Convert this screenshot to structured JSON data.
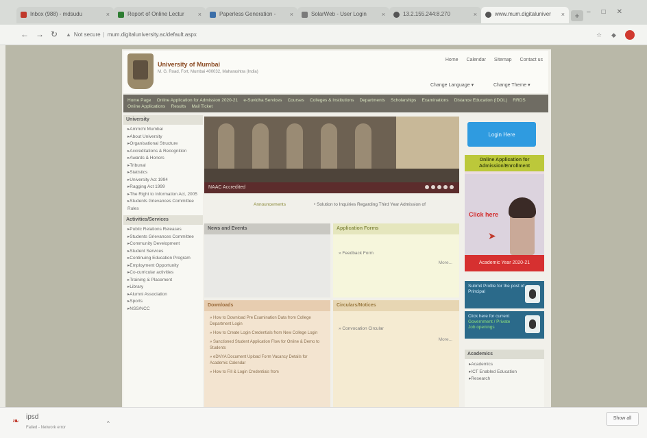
{
  "browser": {
    "tabs": [
      {
        "label": "Inbox (988) - mdsudu",
        "icon_color": "#c0392b"
      },
      {
        "label": "Report of Online Lectur",
        "icon_color": "#2e7d32"
      },
      {
        "label": "Paperless Generation -",
        "icon_color": "#3b6ea8"
      },
      {
        "label": "SolarWeb - User Login",
        "icon_color": "#7a7a7a"
      },
      {
        "label": "13.2.155.244:8.270",
        "icon_color": "#555555"
      },
      {
        "label": "www.mum.digitaluniver",
        "icon_color": "#555555"
      }
    ],
    "new_tab": "+",
    "address": {
      "security": "Not secure",
      "url": "mum.digitaluniversity.ac/default.aspx"
    }
  },
  "site": {
    "name": "University of Mumbai",
    "subtitle": "M. G. Road, Fort, Mumbai 400032, Maharashtra (India)",
    "top_links": [
      "Home",
      "Calendar",
      "Sitemap",
      "Contact us"
    ],
    "change_language": "Change Language",
    "change_theme": "Change Theme",
    "menu": [
      "Home Page",
      "Online Application for Admission 2020-21",
      "e-Suvidha Services",
      "Courses",
      "Colleges & Institutions",
      "Departments",
      "Scholarships",
      "Examinations",
      "Distance Education (IDOL)",
      "RRDS",
      "Online Applications",
      "Results",
      "Mail Ticket"
    ],
    "university_head": "University",
    "university_items": [
      "Ammchi Mumbai",
      "About University",
      "Organisational Structure",
      "Accreditations & Recognition",
      "Awards & Honors",
      "Tribunal",
      "Statistics",
      "University Act 1994",
      "Ragging Act 1999",
      "The Right to Information Act, 2005",
      "Students Grievances Committee Rules"
    ],
    "activities_head": "Activities/Services",
    "activities_items": [
      "Public Relations Releases",
      "Students Grievances Committee",
      "Community Development",
      "Student Services",
      "Continuing Education Program",
      "Employment Opportunity",
      "Co-curricular activities",
      "Training & Placement",
      "Library",
      "Alumni Association",
      "Sports",
      "NSS/NCC"
    ],
    "banner_caption": "NAAC Accredited",
    "announcements_label": "Announcements",
    "announcement_text": "Solution to Inquiries Regarding Third Year Admission of",
    "news_head": "News and Events",
    "app_forms_head": "Application Forms",
    "app_forms_link": "Feedback Form",
    "more": "More...",
    "downloads_head": "Downloads",
    "downloads": [
      "How to Download Pre Examination Data from College Department Login",
      "How to Create Login Credentials from New College Login",
      "Sanctioned Student Application Flow for Online & Demo to Students",
      "eDNYA Document Upload Form Vacancy Details for Academic Calendar",
      "How to Fill & Login Credentials from"
    ],
    "circulars_head": "Circulars/Notices",
    "circulars_link": "Convocation Circular",
    "login_label": "Login Here",
    "adm_head": "Online Application for Admission/Enrollment",
    "click_here": "Click here",
    "adm_year": "Academic Year 2020-21",
    "principal_box": "Submit Profile for the post of Principal",
    "jobs_box_1": "Click here for current",
    "jobs_box_2": "Government / Private",
    "jobs_box_3": "Job openings",
    "academics_head": "Academics",
    "academics_items": [
      "Academics",
      "ICT Enabled Education",
      "Research"
    ]
  },
  "downloads_shelf": {
    "file": "ipsd",
    "status": "Failed - Network error",
    "show_all": "Show all"
  }
}
